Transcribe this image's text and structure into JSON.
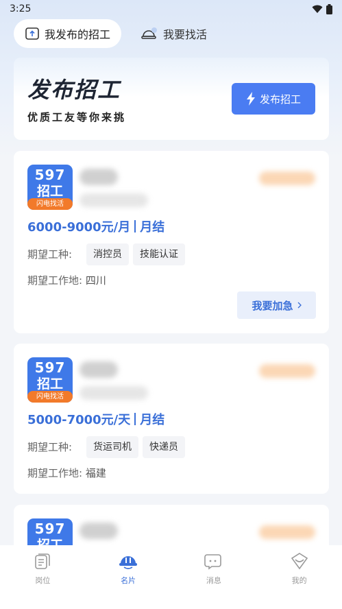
{
  "status_bar": {
    "time": "3:25"
  },
  "tabs": [
    {
      "label": "我发布的招工",
      "icon": "send-box-icon",
      "active": true
    },
    {
      "label": "我要找活",
      "icon": "hardhat-chat-icon",
      "active": false
    }
  ],
  "publish": {
    "title": "发布招工",
    "subtitle": "优质工友等你来挑",
    "button_label": "发布招工",
    "button_icon": "lightning-icon"
  },
  "logo": {
    "line1": "597",
    "line2": "招工",
    "tag": "闪电找活"
  },
  "jobs": [
    {
      "salary": "6000-9000元/月",
      "settle": "月结",
      "work_types_label": "期望工种:",
      "work_types": [
        "消控员",
        "技能认证"
      ],
      "location_label": "期望工作地:",
      "location": "四川",
      "urgent_label": "我要加急"
    },
    {
      "salary": "5000-7000元/天",
      "settle": "月结",
      "work_types_label": "期望工种:",
      "work_types": [
        "货运司机",
        "快递员"
      ],
      "location_label": "期望工作地:",
      "location": "福建"
    }
  ],
  "bottom_nav": [
    {
      "label": "岗位",
      "icon": "document-stack-icon",
      "active": false
    },
    {
      "label": "名片",
      "icon": "hardhat-icon",
      "active": true
    },
    {
      "label": "消息",
      "icon": "chat-bubble-icon",
      "active": false
    },
    {
      "label": "我的",
      "icon": "heart-badge-icon",
      "active": false
    }
  ],
  "colors": {
    "accent": "#4a7cf2",
    "orange": "#f27a2a",
    "logo_blue": "#3f79e8"
  }
}
